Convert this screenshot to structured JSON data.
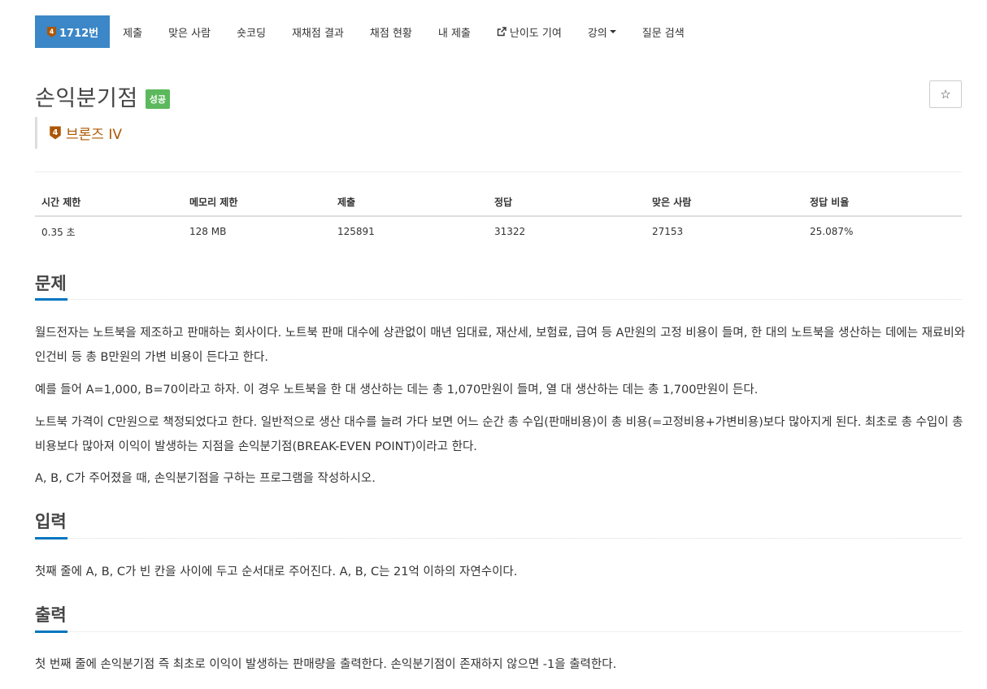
{
  "nav": {
    "problem_number": "1712번",
    "items": [
      "제출",
      "맞은 사람",
      "숏코딩",
      "재채점 결과",
      "채점 현황",
      "내 제출",
      "난이도 기여",
      "강의",
      "질문 검색"
    ]
  },
  "problem": {
    "title": "손익분기점",
    "status": "성공",
    "tier": "브론즈 IV",
    "tier_badge_digit": "4",
    "star": "☆"
  },
  "stats": {
    "headers": [
      "시간 제한",
      "메모리 제한",
      "제출",
      "정답",
      "맞은 사람",
      "정답 비율"
    ],
    "values": [
      "0.35 초",
      "128 MB",
      "125891",
      "31322",
      "27153",
      "25.087%"
    ]
  },
  "sections": {
    "problem": {
      "heading": "문제",
      "paragraphs": [
        "월드전자는 노트북을 제조하고 판매하는 회사이다. 노트북 판매 대수에 상관없이 매년 임대료, 재산세, 보험료, 급여 등 A만원의 고정 비용이 들며, 한 대의 노트북을 생산하는 데에는 재료비와 인건비 등 총 B만원의 가변 비용이 든다고 한다.",
        "예를 들어 A=1,000, B=70이라고 하자. 이 경우 노트북을 한 대 생산하는 데는 총 1,070만원이 들며, 열 대 생산하는 데는 총 1,700만원이 든다.",
        "노트북 가격이 C만원으로 책정되었다고 한다. 일반적으로 생산 대수를 늘려 가다 보면 어느 순간 총 수입(판매비용)이 총 비용(=고정비용+가변비용)보다 많아지게 된다. 최초로 총 수입이 총 비용보다 많아져 이익이 발생하는 지점을 손익분기점(BREAK-EVEN POINT)이라고 한다.",
        "A, B, C가 주어졌을 때, 손익분기점을 구하는 프로그램을 작성하시오."
      ]
    },
    "input": {
      "heading": "입력",
      "text": "첫째 줄에 A, B, C가 빈 칸을 사이에 두고 순서대로 주어진다. A, B, C는 21억 이하의 자연수이다."
    },
    "output": {
      "heading": "출력",
      "text": "첫 번째 줄에 손익분기점 즉 최초로 이익이 발생하는 판매량을 출력한다. 손익분기점이 존재하지 않으면 -1을 출력한다."
    }
  },
  "colors": {
    "nav_active": "#3b87c7",
    "status_success": "#5cb85c",
    "tier_bronze": "#ad5600",
    "section_accent": "#0076c0"
  }
}
